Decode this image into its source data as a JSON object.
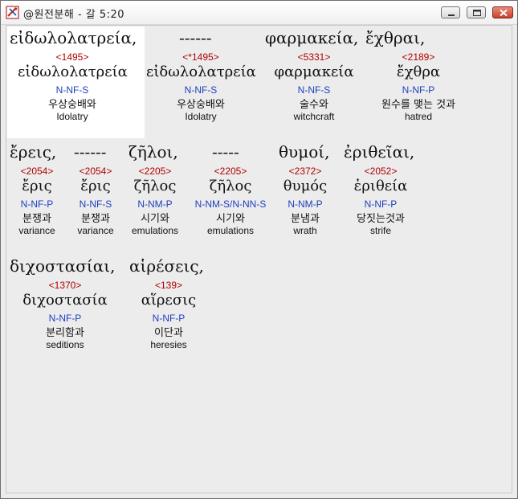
{
  "window": {
    "title": "@원전분해 - 갈 5:20",
    "icon": "tools-icon"
  },
  "rows": [
    {
      "greek_text": [
        "εἰδωλολατρεία,",
        "------",
        "φαρμακεία,",
        "ἔχθραι,"
      ],
      "entries": [
        {
          "strong": "<1495>",
          "lemma": "εἰδωλολατρεία",
          "morph": "N-NF-S",
          "korean": "우상숭배와",
          "english": "Idolatry"
        },
        {
          "strong": "<*1495>",
          "lemma": "εἰδωλολατρεία",
          "morph": "N-NF-S",
          "korean": "우상숭배와",
          "english": "Idolatry"
        },
        {
          "strong": "<5331>",
          "lemma": "φαρμακεία",
          "morph": "N-NF-S",
          "korean": "술수와",
          "english": "witchcraft"
        },
        {
          "strong": "<2189>",
          "lemma": "ἔχθρα",
          "morph": "N-NF-P",
          "korean": "원수를 맺는 것과",
          "english": "hatred"
        }
      ]
    },
    {
      "greek_text": [
        "ἔρεις,",
        "------",
        "ζῆλοι,",
        "-----",
        "θυμοί,",
        "ἐριθεῖαι,"
      ],
      "entries": [
        {
          "strong": "<2054>",
          "lemma": "ἔρις",
          "morph": "N-NF-P",
          "korean": "분쟁과",
          "english": "variance"
        },
        {
          "strong": "<2054>",
          "lemma": "ἔρις",
          "morph": "N-NF-S",
          "korean": "분쟁과",
          "english": "variance"
        },
        {
          "strong": "<2205>",
          "lemma": "ζῆλος",
          "morph": "N-NM-P",
          "korean": "시기와",
          "english": "emulations"
        },
        {
          "strong": "<2205>",
          "lemma": "ζῆλος",
          "morph": "N-NM-S/N-NN-S",
          "korean": "시기와",
          "english": "emulations"
        },
        {
          "strong": "<2372>",
          "lemma": "θυμός",
          "morph": "N-NM-P",
          "korean": "분냄과",
          "english": "wrath"
        },
        {
          "strong": "<2052>",
          "lemma": "ἐριθεία",
          "morph": "N-NF-P",
          "korean": "당짓는것과",
          "english": "strife"
        }
      ]
    },
    {
      "greek_text": [
        "διχοστασίαι,",
        "αἱρέσεις,"
      ],
      "entries": [
        {
          "strong": "<1370>",
          "lemma": "διχοστασία",
          "morph": "N-NF-P",
          "korean": "분리함과",
          "english": "seditions"
        },
        {
          "strong": "<139>",
          "lemma": "αἵρεσις",
          "morph": "N-NF-P",
          "korean": "이단과",
          "english": "heresies"
        }
      ]
    }
  ]
}
